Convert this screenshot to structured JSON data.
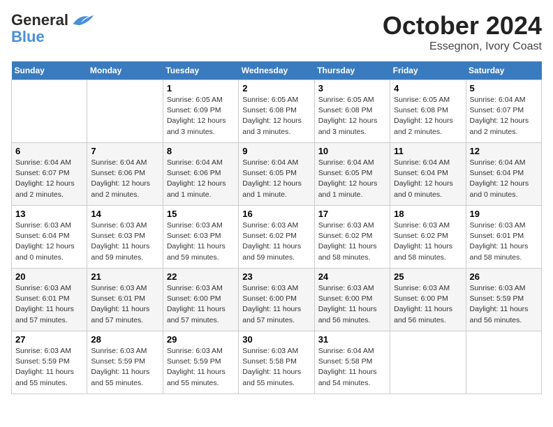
{
  "header": {
    "logo_line1": "General",
    "logo_line2": "Blue",
    "month": "October 2024",
    "location": "Essegnon, Ivory Coast"
  },
  "weekdays": [
    "Sunday",
    "Monday",
    "Tuesday",
    "Wednesday",
    "Thursday",
    "Friday",
    "Saturday"
  ],
  "weeks": [
    [
      {
        "day": "",
        "info": ""
      },
      {
        "day": "",
        "info": ""
      },
      {
        "day": "1",
        "info": "Sunrise: 6:05 AM\nSunset: 6:09 PM\nDaylight: 12 hours\nand 3 minutes."
      },
      {
        "day": "2",
        "info": "Sunrise: 6:05 AM\nSunset: 6:08 PM\nDaylight: 12 hours\nand 3 minutes."
      },
      {
        "day": "3",
        "info": "Sunrise: 6:05 AM\nSunset: 6:08 PM\nDaylight: 12 hours\nand 3 minutes."
      },
      {
        "day": "4",
        "info": "Sunrise: 6:05 AM\nSunset: 6:08 PM\nDaylight: 12 hours\nand 2 minutes."
      },
      {
        "day": "5",
        "info": "Sunrise: 6:04 AM\nSunset: 6:07 PM\nDaylight: 12 hours\nand 2 minutes."
      }
    ],
    [
      {
        "day": "6",
        "info": "Sunrise: 6:04 AM\nSunset: 6:07 PM\nDaylight: 12 hours\nand 2 minutes."
      },
      {
        "day": "7",
        "info": "Sunrise: 6:04 AM\nSunset: 6:06 PM\nDaylight: 12 hours\nand 2 minutes."
      },
      {
        "day": "8",
        "info": "Sunrise: 6:04 AM\nSunset: 6:06 PM\nDaylight: 12 hours\nand 1 minute."
      },
      {
        "day": "9",
        "info": "Sunrise: 6:04 AM\nSunset: 6:05 PM\nDaylight: 12 hours\nand 1 minute."
      },
      {
        "day": "10",
        "info": "Sunrise: 6:04 AM\nSunset: 6:05 PM\nDaylight: 12 hours\nand 1 minute."
      },
      {
        "day": "11",
        "info": "Sunrise: 6:04 AM\nSunset: 6:04 PM\nDaylight: 12 hours\nand 0 minutes."
      },
      {
        "day": "12",
        "info": "Sunrise: 6:04 AM\nSunset: 6:04 PM\nDaylight: 12 hours\nand 0 minutes."
      }
    ],
    [
      {
        "day": "13",
        "info": "Sunrise: 6:03 AM\nSunset: 6:04 PM\nDaylight: 12 hours\nand 0 minutes."
      },
      {
        "day": "14",
        "info": "Sunrise: 6:03 AM\nSunset: 6:03 PM\nDaylight: 11 hours\nand 59 minutes."
      },
      {
        "day": "15",
        "info": "Sunrise: 6:03 AM\nSunset: 6:03 PM\nDaylight: 11 hours\nand 59 minutes."
      },
      {
        "day": "16",
        "info": "Sunrise: 6:03 AM\nSunset: 6:02 PM\nDaylight: 11 hours\nand 59 minutes."
      },
      {
        "day": "17",
        "info": "Sunrise: 6:03 AM\nSunset: 6:02 PM\nDaylight: 11 hours\nand 58 minutes."
      },
      {
        "day": "18",
        "info": "Sunrise: 6:03 AM\nSunset: 6:02 PM\nDaylight: 11 hours\nand 58 minutes."
      },
      {
        "day": "19",
        "info": "Sunrise: 6:03 AM\nSunset: 6:01 PM\nDaylight: 11 hours\nand 58 minutes."
      }
    ],
    [
      {
        "day": "20",
        "info": "Sunrise: 6:03 AM\nSunset: 6:01 PM\nDaylight: 11 hours\nand 57 minutes."
      },
      {
        "day": "21",
        "info": "Sunrise: 6:03 AM\nSunset: 6:01 PM\nDaylight: 11 hours\nand 57 minutes."
      },
      {
        "day": "22",
        "info": "Sunrise: 6:03 AM\nSunset: 6:00 PM\nDaylight: 11 hours\nand 57 minutes."
      },
      {
        "day": "23",
        "info": "Sunrise: 6:03 AM\nSunset: 6:00 PM\nDaylight: 11 hours\nand 57 minutes."
      },
      {
        "day": "24",
        "info": "Sunrise: 6:03 AM\nSunset: 6:00 PM\nDaylight: 11 hours\nand 56 minutes."
      },
      {
        "day": "25",
        "info": "Sunrise: 6:03 AM\nSunset: 6:00 PM\nDaylight: 11 hours\nand 56 minutes."
      },
      {
        "day": "26",
        "info": "Sunrise: 6:03 AM\nSunset: 5:59 PM\nDaylight: 11 hours\nand 56 minutes."
      }
    ],
    [
      {
        "day": "27",
        "info": "Sunrise: 6:03 AM\nSunset: 5:59 PM\nDaylight: 11 hours\nand 55 minutes."
      },
      {
        "day": "28",
        "info": "Sunrise: 6:03 AM\nSunset: 5:59 PM\nDaylight: 11 hours\nand 55 minutes."
      },
      {
        "day": "29",
        "info": "Sunrise: 6:03 AM\nSunset: 5:59 PM\nDaylight: 11 hours\nand 55 minutes."
      },
      {
        "day": "30",
        "info": "Sunrise: 6:03 AM\nSunset: 5:58 PM\nDaylight: 11 hours\nand 55 minutes."
      },
      {
        "day": "31",
        "info": "Sunrise: 6:04 AM\nSunset: 5:58 PM\nDaylight: 11 hours\nand 54 minutes."
      },
      {
        "day": "",
        "info": ""
      },
      {
        "day": "",
        "info": ""
      }
    ]
  ]
}
